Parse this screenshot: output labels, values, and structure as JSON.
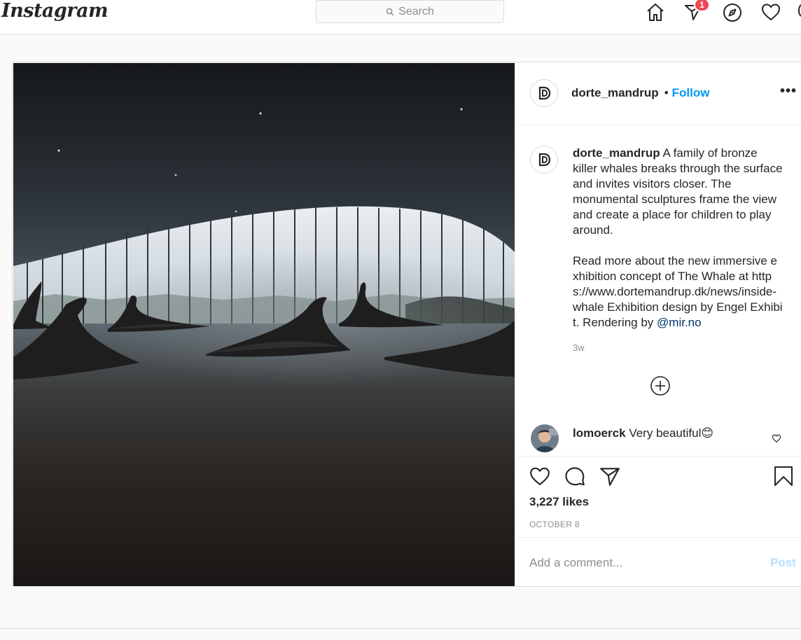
{
  "header": {
    "logo": "Instagram",
    "search_placeholder": "Search",
    "notification_count": "1"
  },
  "post": {
    "author": "dorte_mandrup",
    "follow_label": "Follow",
    "separator": "•",
    "more_label": "•••",
    "caption_text": "A family of bronze killer whales breaks through the surface and invites visitors closer. The monumental sculptures frame the view and create a place for children to play around.",
    "caption_text_2": "Read more about the new immersive exhibition concept of The Whale at https://www.dortemandrup.dk/news/inside-whale Exhibition design by Engel Exhibit. Rendering by",
    "caption_mention": "@mir.no",
    "time_ago": "3w",
    "comment": {
      "user": "lomoerck",
      "text": "Very beautiful😊"
    },
    "likes": "3,227 likes",
    "date": "OCTOBER 8",
    "add_comment_placeholder": "Add a comment...",
    "post_label": "Post"
  },
  "colors": {
    "accent": "#0095f6",
    "badge": "#ed4956",
    "mention": "#00376b"
  }
}
